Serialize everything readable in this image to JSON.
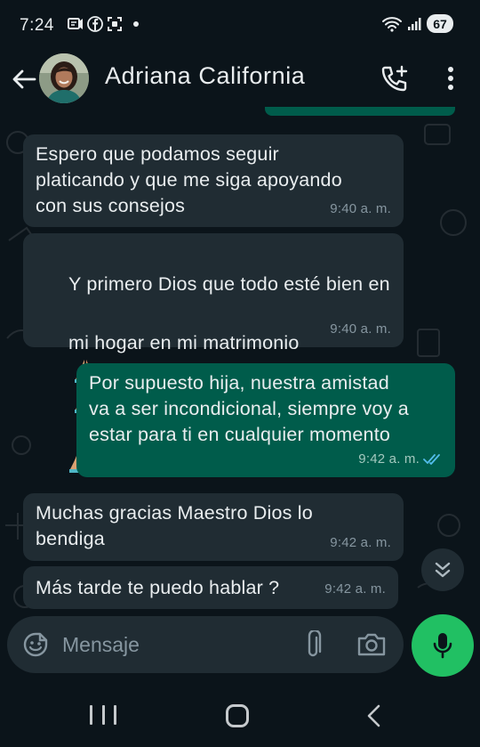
{
  "status_bar": {
    "time": "7:24",
    "battery": "67",
    "icons": [
      "notification-icon",
      "facebook-icon",
      "screenshot-icon",
      "wifi-icon",
      "signal-icon"
    ]
  },
  "header": {
    "contact_name": "Adriana California",
    "icons": [
      "back-arrow-icon",
      "add-call-icon",
      "more-vert-icon"
    ]
  },
  "messages": [
    {
      "direction": "in",
      "lines": "Espero que podamos seguir\nplaticando y que me siga apoyando\ncon sus consejos",
      "time": "9:40 a. m."
    },
    {
      "direction": "in",
      "line1": "Y primero Dios que todo esté bien en",
      "line2": "mi hogar en mi matrimonio",
      "emoji": "folded-hands-emoji",
      "time": "9:40 a. m."
    },
    {
      "direction": "out",
      "lines": "Por supuesto hija, nuestra amistad\nva a ser incondicional, siempre voy a\nestar para ti en cualquier momento",
      "time": "9:42 a. m.",
      "status": "read"
    },
    {
      "direction": "in",
      "lines": "Muchas gracias Maestro Dios lo\nbendiga",
      "time": "9:42 a. m."
    },
    {
      "direction": "in",
      "lines": "Más tarde te puedo hablar ?",
      "time": "9:42 a. m."
    }
  ],
  "composer": {
    "placeholder": "Mensaje",
    "value": "",
    "icons": [
      "emoji-icon",
      "attach-icon",
      "camera-icon",
      "mic-icon"
    ]
  },
  "colors": {
    "background": "#0b141a",
    "incoming_bubble": "#202c33",
    "outgoing_bubble": "#005c4b",
    "accent_green": "#21c063",
    "read_ticks": "#53bdeb"
  }
}
